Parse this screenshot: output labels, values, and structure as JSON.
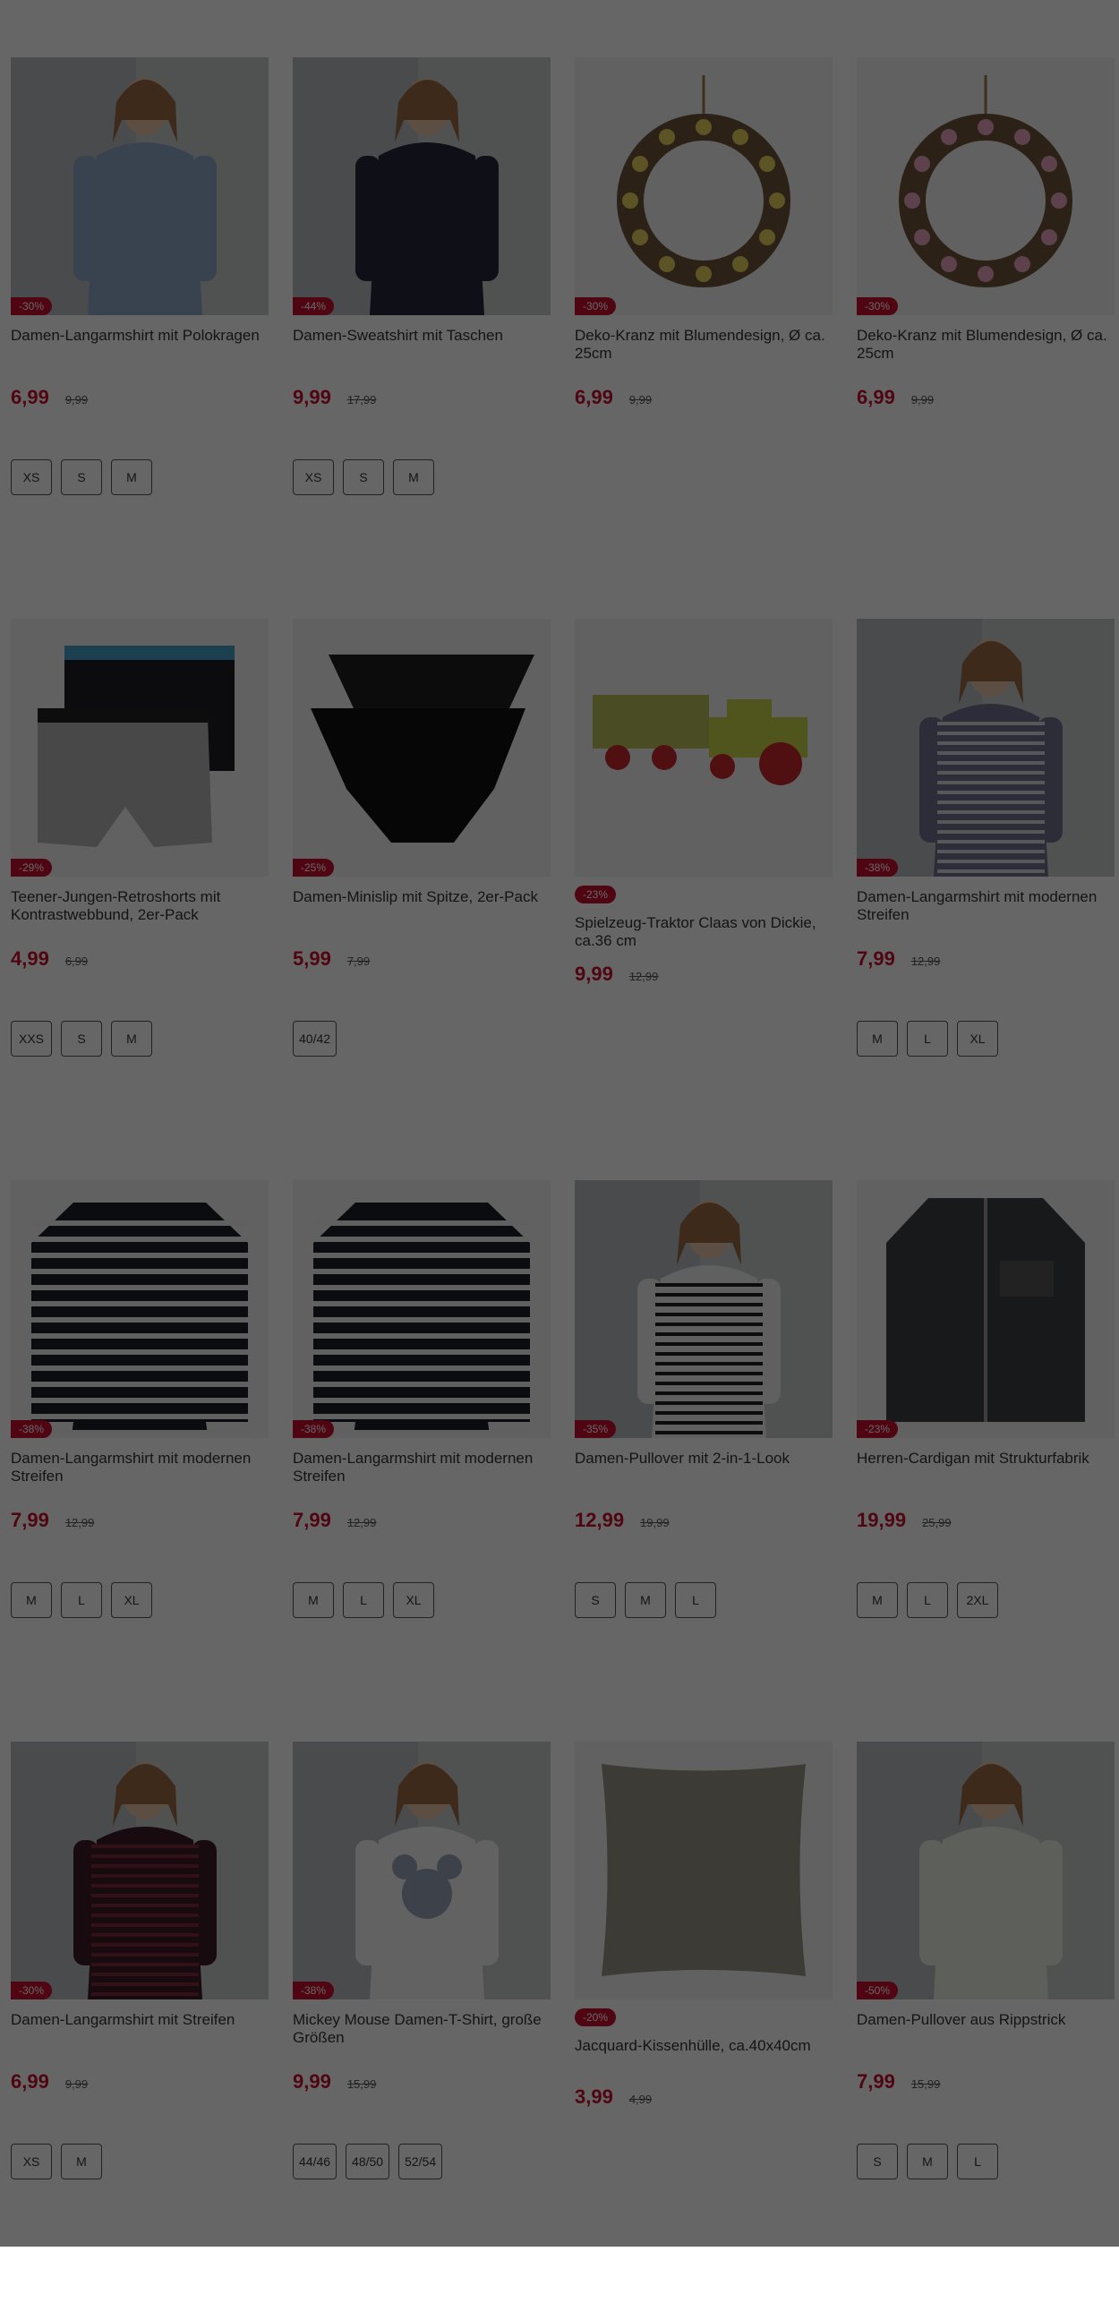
{
  "products": [
    {
      "title": "Damen-Langarmshirt mit Polokragen",
      "discount": "-30%",
      "price": "6,99",
      "old_price": "9,99",
      "sizes": [
        "XS",
        "S",
        "M"
      ],
      "image": "woman-polo-shirt"
    },
    {
      "title": "Damen-Sweatshirt mit Taschen",
      "discount": "-44%",
      "price": "9,99",
      "old_price": "17,99",
      "sizes": [
        "XS",
        "S",
        "M"
      ],
      "image": "woman-navy-sweatshirt"
    },
    {
      "title": "Deko-Kranz mit Blumendesign, Ø ca. 25cm",
      "discount": "-30%",
      "price": "6,99",
      "old_price": "9,99",
      "sizes": [],
      "image": "yellow-flower-wreath"
    },
    {
      "title": "Deko-Kranz mit Blumendesign, Ø ca. 25cm",
      "discount": "-30%",
      "price": "6,99",
      "old_price": "9,99",
      "sizes": [],
      "image": "pink-flower-wreath"
    },
    {
      "title": "Teener-Jungen-Retroshorts mit Kontrastwebbund, 2er-Pack",
      "discount": "-29%",
      "price": "4,99",
      "old_price": "6,99",
      "sizes": [
        "XXS",
        "S",
        "M"
      ],
      "image": "boys-retroshorts"
    },
    {
      "title": "Damen-Minislip mit Spitze, 2er-Pack",
      "discount": "-25%",
      "price": "5,99",
      "old_price": "7,99",
      "sizes": [
        "40/42"
      ],
      "image": "black-minislips"
    },
    {
      "title": "Spielzeug-Traktor Claas von Dickie, ca.36 cm",
      "discount": "-23%",
      "price": "9,99",
      "old_price": "12,99",
      "sizes": [],
      "image": "toy-tractor"
    },
    {
      "title": "Damen-Langarmshirt mit modernen Streifen",
      "discount": "-38%",
      "price": "7,99",
      "old_price": "12,99",
      "sizes": [
        "M",
        "L",
        "XL"
      ],
      "image": "woman-striped-shirt-outdoor"
    },
    {
      "title": "Damen-Langarmshirt mit modernen Streifen",
      "discount": "-38%",
      "price": "7,99",
      "old_price": "12,99",
      "sizes": [
        "M",
        "L",
        "XL"
      ],
      "image": "striped-shirt"
    },
    {
      "title": "Damen-Langarmshirt mit modernen Streifen",
      "discount": "-38%",
      "price": "7,99",
      "old_price": "12,99",
      "sizes": [
        "M",
        "L",
        "XL"
      ],
      "image": "striped-shirt"
    },
    {
      "title": "Damen-Pullover mit 2-in-1-Look",
      "discount": "-35%",
      "price": "12,99",
      "old_price": "19,99",
      "sizes": [
        "S",
        "M",
        "L"
      ],
      "image": "woman-striped-pullover"
    },
    {
      "title": "Herren-Cardigan mit Strukturfabrik",
      "discount": "-23%",
      "price": "19,99",
      "old_price": "25,99",
      "sizes": [
        "M",
        "L",
        "2XL"
      ],
      "image": "men-grey-cardigan"
    },
    {
      "title": "Damen-Langarmshirt mit Streifen",
      "discount": "-30%",
      "price": "6,99",
      "old_price": "9,99",
      "sizes": [
        "XS",
        "M"
      ],
      "image": "woman-burgundy-striped-shirt"
    },
    {
      "title": "Mickey Mouse Damen-T-Shirt, große Größen",
      "discount": "-38%",
      "price": "9,99",
      "old_price": "15,99",
      "sizes": [
        "44/46",
        "48/50",
        "52/54"
      ],
      "image": "woman-mickey-tshirt"
    },
    {
      "title": "Jacquard-Kissenhülle, ca.40x40cm",
      "discount": "-20%",
      "price": "3,99",
      "old_price": "4,99",
      "sizes": [],
      "image": "grey-cushion"
    },
    {
      "title": "Damen-Pullover aus Rippstrick",
      "discount": "-50%",
      "price": "7,99",
      "old_price": "15,99",
      "sizes": [
        "S",
        "M",
        "L"
      ],
      "image": "woman-light-pullover"
    }
  ]
}
